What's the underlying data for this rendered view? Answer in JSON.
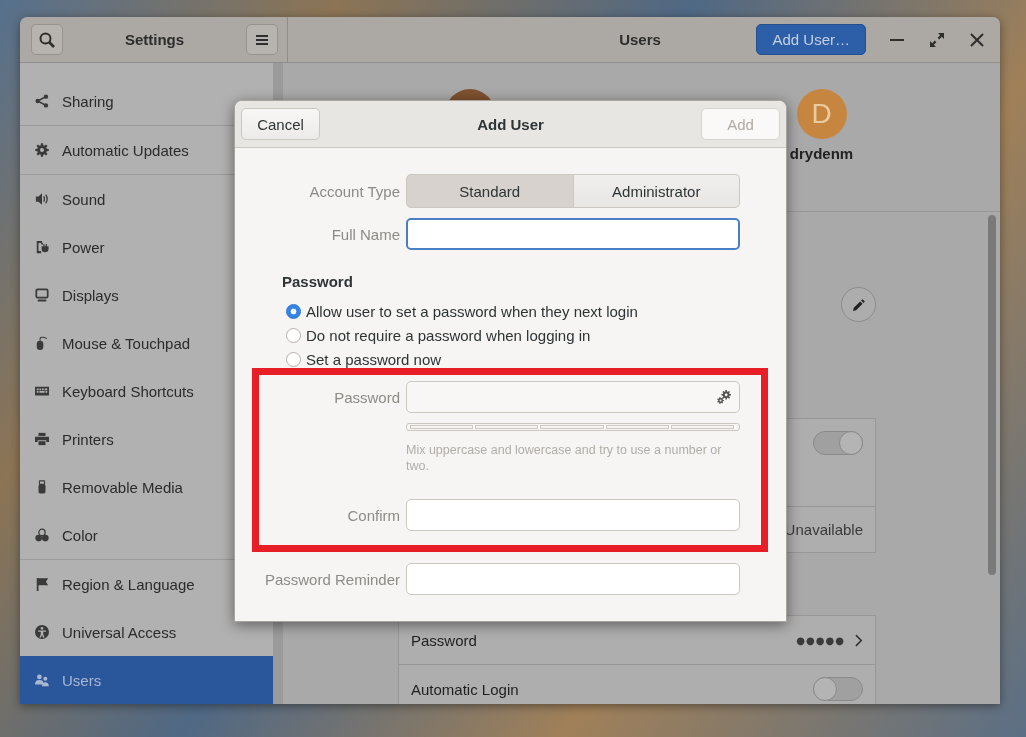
{
  "window": {
    "sidebar_header": {
      "title": "Settings"
    },
    "header": {
      "title": "Users",
      "add_button": "Add User…"
    },
    "sidebar": {
      "groups": [
        {
          "items": [
            {
              "label": "Sharing",
              "selected": false
            }
          ]
        },
        {
          "items": [
            {
              "label": "Automatic Updates",
              "selected": false
            }
          ]
        },
        {
          "items": [
            {
              "label": "Sound",
              "selected": false
            },
            {
              "label": "Power",
              "selected": false
            },
            {
              "label": "Displays",
              "selected": false
            },
            {
              "label": "Mouse & Touchpad",
              "selected": false
            },
            {
              "label": "Keyboard Shortcuts",
              "selected": false
            },
            {
              "label": "Printers",
              "selected": false
            },
            {
              "label": "Removable Media",
              "selected": false
            },
            {
              "label": "Color",
              "selected": false
            }
          ]
        },
        {
          "items": [
            {
              "label": "Region & Language",
              "selected": false
            },
            {
              "label": "Universal Access",
              "selected": false
            },
            {
              "label": "Users",
              "selected": true
            }
          ]
        }
      ]
    },
    "users": {
      "avatars": [
        {
          "color": "#7e5230"
        },
        {
          "initial": "D",
          "name": "drydenm",
          "color": "#c7863f"
        }
      ]
    },
    "account": {
      "cards": [
        {
          "rows": [
            {
              "kind": "toggle",
              "on": true
            },
            {
              "kind": "value",
              "value": "Unavailable"
            }
          ]
        },
        {
          "rows": [
            {
              "kind": "link",
              "label": "Password",
              "value": "●●●●●"
            },
            {
              "kind": "toggle",
              "label": "Automatic Login",
              "on": false
            }
          ]
        }
      ]
    }
  },
  "dialog": {
    "title": "Add User",
    "cancel_button": "Cancel",
    "add_button": {
      "label": "Add",
      "disabled": true
    },
    "account_type": {
      "label": "Account Type",
      "options": [
        {
          "label": "Standard",
          "selected": true
        },
        {
          "label": "Administrator",
          "selected": false
        }
      ]
    },
    "full_name": {
      "label": "Full Name",
      "focused": true
    },
    "password": {
      "heading": "Password",
      "options": [
        {
          "label": "Allow user to set a password when they next login",
          "selected": true
        },
        {
          "label": "Do not require a password when logging in",
          "selected": false
        },
        {
          "label": "Set a password now",
          "selected": false
        }
      ]
    },
    "new_password": {
      "label": "Password",
      "hint": "Mix uppercase and lowercase and try to use a number or two."
    },
    "confirm": {
      "label": "Confirm"
    },
    "reminder": {
      "label": "Password Reminder"
    }
  }
}
